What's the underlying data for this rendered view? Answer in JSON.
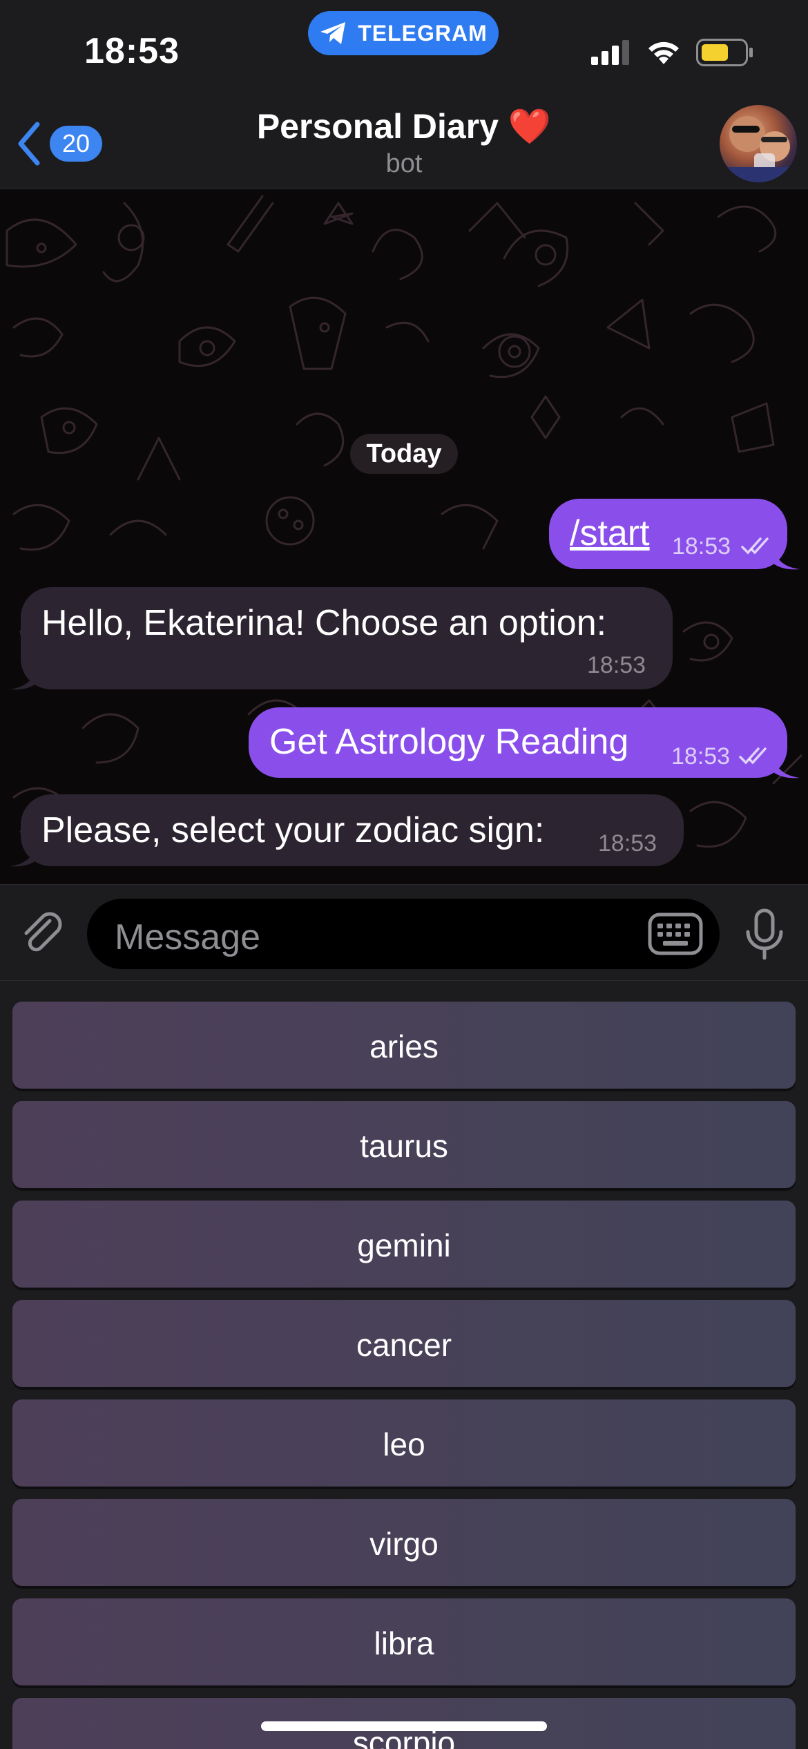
{
  "status_bar": {
    "time": "18:53",
    "source_app": "TELEGRAM",
    "icons": [
      "cellular-signal-icon",
      "wifi-icon",
      "battery-icon"
    ]
  },
  "header": {
    "back_count": "20",
    "title": "Personal Diary ❤️",
    "subtitle": "bot"
  },
  "chat": {
    "date_separator": "Today",
    "messages": [
      {
        "direction": "outgoing",
        "text": "/start",
        "time": "18:53",
        "status": "read"
      },
      {
        "direction": "incoming",
        "text": "Hello, Ekaterina! Choose an option:",
        "time": "18:53"
      },
      {
        "direction": "outgoing",
        "text": "Get Astrology Reading",
        "time": "18:53",
        "status": "read"
      },
      {
        "direction": "incoming",
        "text": "Please, select your zodiac sign:",
        "time": "18:53"
      }
    ]
  },
  "input": {
    "placeholder": "Message"
  },
  "keyboard": {
    "buttons": [
      "aries",
      "taurus",
      "gemini",
      "cancer",
      "leo",
      "virgo",
      "libra",
      "scorpio"
    ]
  },
  "colors": {
    "outgoing_bubble": "#8a4fea",
    "incoming_bubble": "#2c2430",
    "accent": "#3d85f0"
  }
}
